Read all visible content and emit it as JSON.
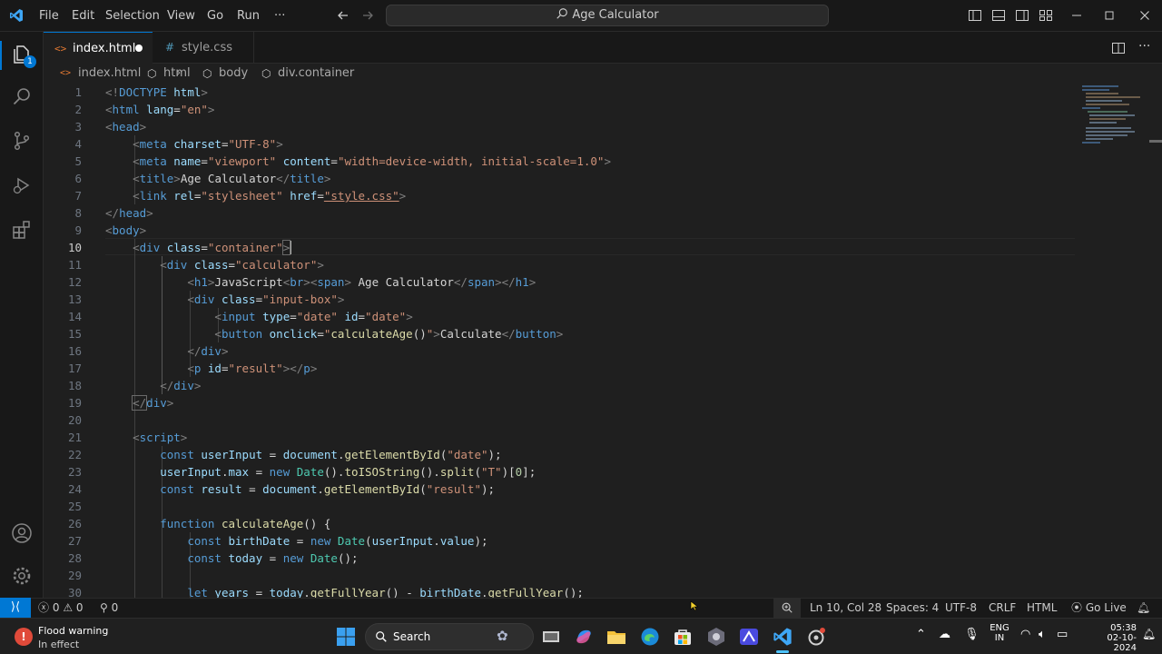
{
  "menu": [
    "File",
    "Edit",
    "Selection",
    "View",
    "Go",
    "Run",
    "···"
  ],
  "command_center": "Age Calculator",
  "tabs": [
    {
      "label": "index.html",
      "icon": "html-file-icon",
      "active": true,
      "modified": true
    },
    {
      "label": "style.css",
      "icon": "css-file-icon",
      "active": false,
      "modified": false
    }
  ],
  "breadcrumb": [
    "index.html",
    "html",
    "body",
    "div.container"
  ],
  "activity": {
    "explorer_badge": "1"
  },
  "editor": {
    "current_line": "10",
    "lines": [
      {
        "n": "1",
        "text": "<!DOCTYPE html>"
      },
      {
        "n": "2",
        "text": "<html lang=\"en\">"
      },
      {
        "n": "3",
        "text": "<head>"
      },
      {
        "n": "4",
        "text": "    <meta charset=\"UTF-8\">"
      },
      {
        "n": "5",
        "text": "    <meta name=\"viewport\" content=\"width=device-width, initial-scale=1.0\">"
      },
      {
        "n": "6",
        "text": "    <title>Age Calculator</title>"
      },
      {
        "n": "7",
        "text": "    <link rel=\"stylesheet\" href=\"style.css\">"
      },
      {
        "n": "8",
        "text": "</head>"
      },
      {
        "n": "9",
        "text": "<body>"
      },
      {
        "n": "10",
        "text": "    <div class=\"container\">"
      },
      {
        "n": "11",
        "text": "        <div class=\"calculator\">"
      },
      {
        "n": "12",
        "text": "            <h1>JavaScript<br><span> Age Calculator</span></h1>"
      },
      {
        "n": "13",
        "text": "            <div class=\"input-box\">"
      },
      {
        "n": "14",
        "text": "                <input type=\"date\" id=\"date\">"
      },
      {
        "n": "15",
        "text": "                <button onclick=\"calculateAge()\">Calculate</button>"
      },
      {
        "n": "16",
        "text": "            </div>"
      },
      {
        "n": "17",
        "text": "            <p id=\"result\"></p>"
      },
      {
        "n": "18",
        "text": "        </div>"
      },
      {
        "n": "19",
        "text": "    </div>"
      },
      {
        "n": "20",
        "text": ""
      },
      {
        "n": "21",
        "text": "    <script>"
      },
      {
        "n": "22",
        "text": "        const userInput = document.getElementById(\"date\");"
      },
      {
        "n": "23",
        "text": "        userInput.max = new Date().toISOString().split(\"T\")[0];"
      },
      {
        "n": "24",
        "text": "        const result = document.getElementById(\"result\");"
      },
      {
        "n": "25",
        "text": ""
      },
      {
        "n": "26",
        "text": "        function calculateAge() {"
      },
      {
        "n": "27",
        "text": "            const birthDate = new Date(userInput.value);"
      },
      {
        "n": "28",
        "text": "            const today = new Date();"
      },
      {
        "n": "29",
        "text": ""
      },
      {
        "n": "30",
        "text": "            let years = today.getFullYear() - birthDate.getFullYear();"
      }
    ]
  },
  "status": {
    "errors": "0",
    "warnings": "0",
    "ports": "0",
    "position": "Ln 10, Col 28",
    "spaces": "Spaces: 4",
    "encoding": "UTF-8",
    "eol": "CRLF",
    "language": "HTML",
    "golive": "Go Live"
  },
  "taskbar": {
    "weather_title": "Flood warning",
    "weather_sub": "In effect",
    "search": "Search",
    "lang1": "ENG",
    "lang2": "IN",
    "time": "05:38",
    "date": "02-10-2024"
  },
  "colors": {
    "accent": "#0078d4",
    "badge": "#0078d4",
    "cursor": "#aeafad"
  }
}
